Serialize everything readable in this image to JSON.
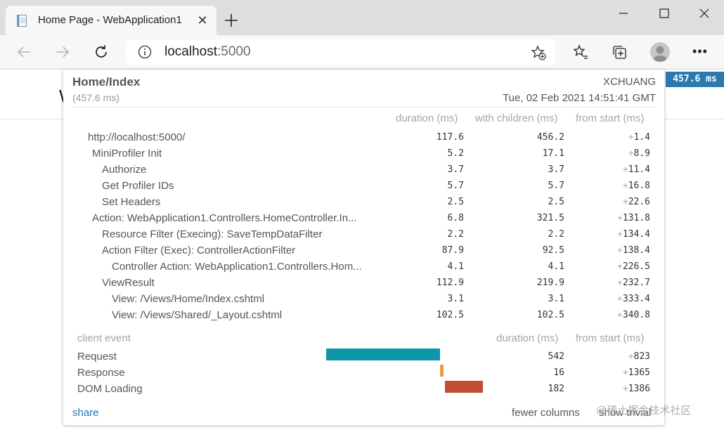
{
  "browser": {
    "tab_title": "Home Page - WebApplication1",
    "url_host": "localhost",
    "url_port": ":5000"
  },
  "page": {
    "heading_peek": "W"
  },
  "profiler_badge": "457.6 ms",
  "profiler": {
    "title": "Home/Index",
    "duration": "(457.6 ms)",
    "machine": "XCHUANG",
    "timestamp": "Tue, 02 Feb 2021 14:51:41 GMT",
    "headers": {
      "duration": "duration (ms)",
      "with_children": "with children (ms)",
      "from_start": "from start (ms)"
    },
    "timings": [
      {
        "label": "http://localhost:5000/",
        "duration": "117.6",
        "with_children": "456.2",
        "from_start": "1.4",
        "depth": 0
      },
      {
        "label": "MiniProfiler Init",
        "duration": "5.2",
        "with_children": "17.1",
        "from_start": "8.9",
        "depth": 1
      },
      {
        "label": "Authorize",
        "duration": "3.7",
        "with_children": "3.7",
        "from_start": "11.4",
        "depth": 2
      },
      {
        "label": "Get Profiler IDs",
        "duration": "5.7",
        "with_children": "5.7",
        "from_start": "16.8",
        "depth": 2
      },
      {
        "label": "Set Headers",
        "duration": "2.5",
        "with_children": "2.5",
        "from_start": "22.6",
        "depth": 2
      },
      {
        "label": "Action: WebApplication1.Controllers.HomeController.In...",
        "duration": "6.8",
        "with_children": "321.5",
        "from_start": "131.8",
        "depth": 1
      },
      {
        "label": "Resource Filter (Execing): SaveTempDataFilter",
        "duration": "2.2",
        "with_children": "2.2",
        "from_start": "134.4",
        "depth": 2
      },
      {
        "label": "Action Filter (Exec): ControllerActionFilter",
        "duration": "87.9",
        "with_children": "92.5",
        "from_start": "138.4",
        "depth": 2
      },
      {
        "label": "Controller Action: WebApplication1.Controllers.Hom...",
        "duration": "4.1",
        "with_children": "4.1",
        "from_start": "226.5",
        "depth": 3
      },
      {
        "label": "ViewResult",
        "duration": "112.9",
        "with_children": "219.9",
        "from_start": "232.7",
        "depth": 2
      },
      {
        "label": "View: /Views/Home/Index.cshtml",
        "duration": "3.1",
        "with_children": "3.1",
        "from_start": "333.4",
        "depth": 3
      },
      {
        "label": "View: /Views/Shared/_Layout.cshtml",
        "duration": "102.5",
        "with_children": "102.5",
        "from_start": "340.8",
        "depth": 3
      }
    ],
    "plus_sign": "+",
    "client_headers": {
      "event": "client event",
      "duration": "duration (ms)",
      "from_start": "from start (ms)"
    },
    "client_events": [
      {
        "label": "Request",
        "duration": "542",
        "from_start": "823",
        "color": "#0e97a9"
      },
      {
        "label": "Response",
        "duration": "16",
        "from_start": "1365",
        "color": "#dfa047"
      },
      {
        "label": "DOM Loading",
        "duration": "182",
        "from_start": "1386",
        "color": "#c04d32"
      }
    ],
    "share_label": "share",
    "fewer_columns_label": "fewer columns",
    "show_trivial_label": "show trivial"
  },
  "watermark": "@稀土掘金技术社区",
  "colors": {
    "badge": "#2a7ab0",
    "link": "#1e78b4"
  }
}
